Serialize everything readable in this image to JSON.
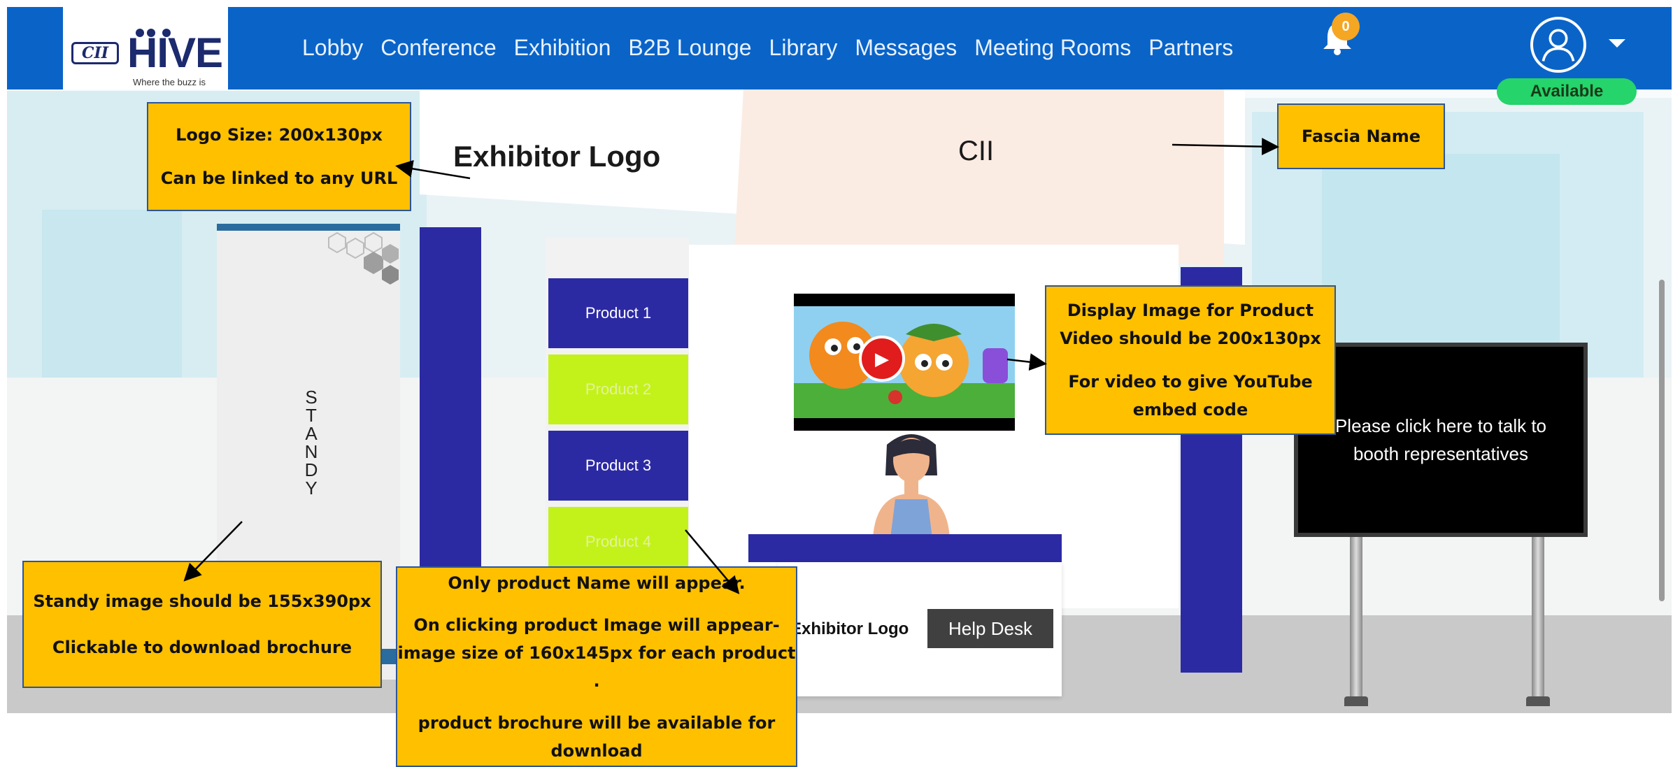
{
  "navbar": {
    "brand_mark": "CII",
    "brand_name": "HIVE",
    "tagline": "Where the buzz is",
    "items": [
      "Lobby",
      "Conference",
      "Exhibition",
      "B2B Lounge",
      "Library",
      "Messages",
      "Meeting Rooms",
      "Partners"
    ],
    "notification_count": "0",
    "status": "Available"
  },
  "booth": {
    "exhibitor_logo": "Exhibitor Logo",
    "fascia_name": "CII",
    "standy_letters": [
      "S",
      "T",
      "A",
      "N",
      "D",
      "Y"
    ],
    "products": [
      "Product 1",
      "Product 2",
      "Product 3",
      "Product 4"
    ],
    "desk_logo": "Exhibitor Logo",
    "help_desk": "Help Desk",
    "tv_text_line1": "Please click here to talk to",
    "tv_text_line2": "booth representatives"
  },
  "callouts": {
    "logo": [
      "Logo Size: 200x130px",
      "Can be linked to any URL"
    ],
    "fascia": [
      "Fascia Name"
    ],
    "video": [
      "Display Image for Product",
      "Video should be  200x130px",
      "For video to give YouTube",
      "embed code"
    ],
    "standy": [
      "Standy image should be 155x390px",
      "Clickable to download brochure"
    ],
    "product": [
      "Only product Name will appear.",
      "On clicking product Image will  appear-",
      "image size of 160x145px for each product .",
      "product brochure will be available for",
      "download"
    ]
  },
  "colors": {
    "nav_blue": "#0a64c8",
    "booth_blue": "#2c2aa3",
    "lime": "#c3f21a",
    "callout_yellow": "#ffc000",
    "available_green": "#25d46a"
  }
}
